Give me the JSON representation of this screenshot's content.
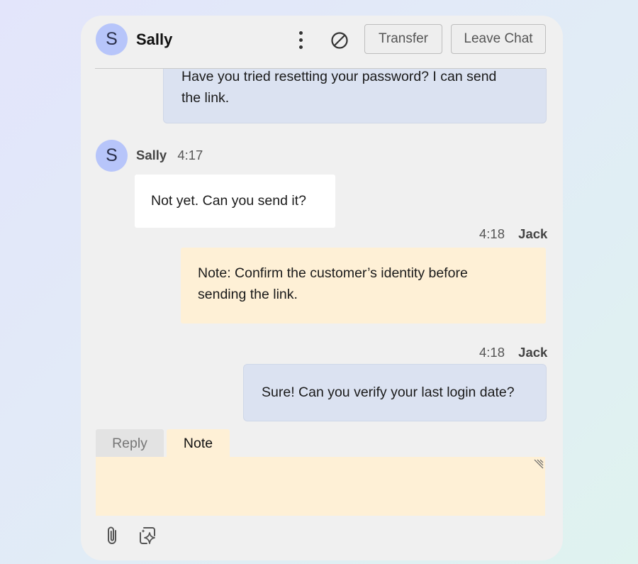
{
  "header": {
    "avatar_initial": "S",
    "name": "Sally",
    "transfer_label": "Transfer",
    "leave_label": "Leave Chat"
  },
  "messages": [
    {
      "type": "agent",
      "text_line1": "Have you tried resetting your password? I can send",
      "text_line2": "the link."
    },
    {
      "type": "customer",
      "avatar_initial": "S",
      "author": "Sally",
      "time": "4:17",
      "text": "Not yet. Can you send it?"
    },
    {
      "type": "note",
      "author": "Jack",
      "time": "4:18",
      "text_line1": "Note: Confirm the customer’s identity before",
      "text_line2": "sending the link."
    },
    {
      "type": "agent",
      "author": "Jack",
      "time": "4:18",
      "text": "Sure! Can you verify your last login date?"
    }
  ],
  "composer": {
    "tabs": [
      "Reply",
      "Note"
    ],
    "active_tab": "Note",
    "value": "",
    "placeholder": ""
  },
  "icons": {
    "more": "kebab-menu-icon",
    "block": "block-icon",
    "attach": "paperclip-icon",
    "ai": "sparkle-icon"
  },
  "colors": {
    "agent_bubble": "#dbe2f1",
    "customer_bubble": "#ffffff",
    "note_bubble": "#fef0d6",
    "avatar": "#b7c5fa",
    "panel": "#f0f0f0"
  }
}
